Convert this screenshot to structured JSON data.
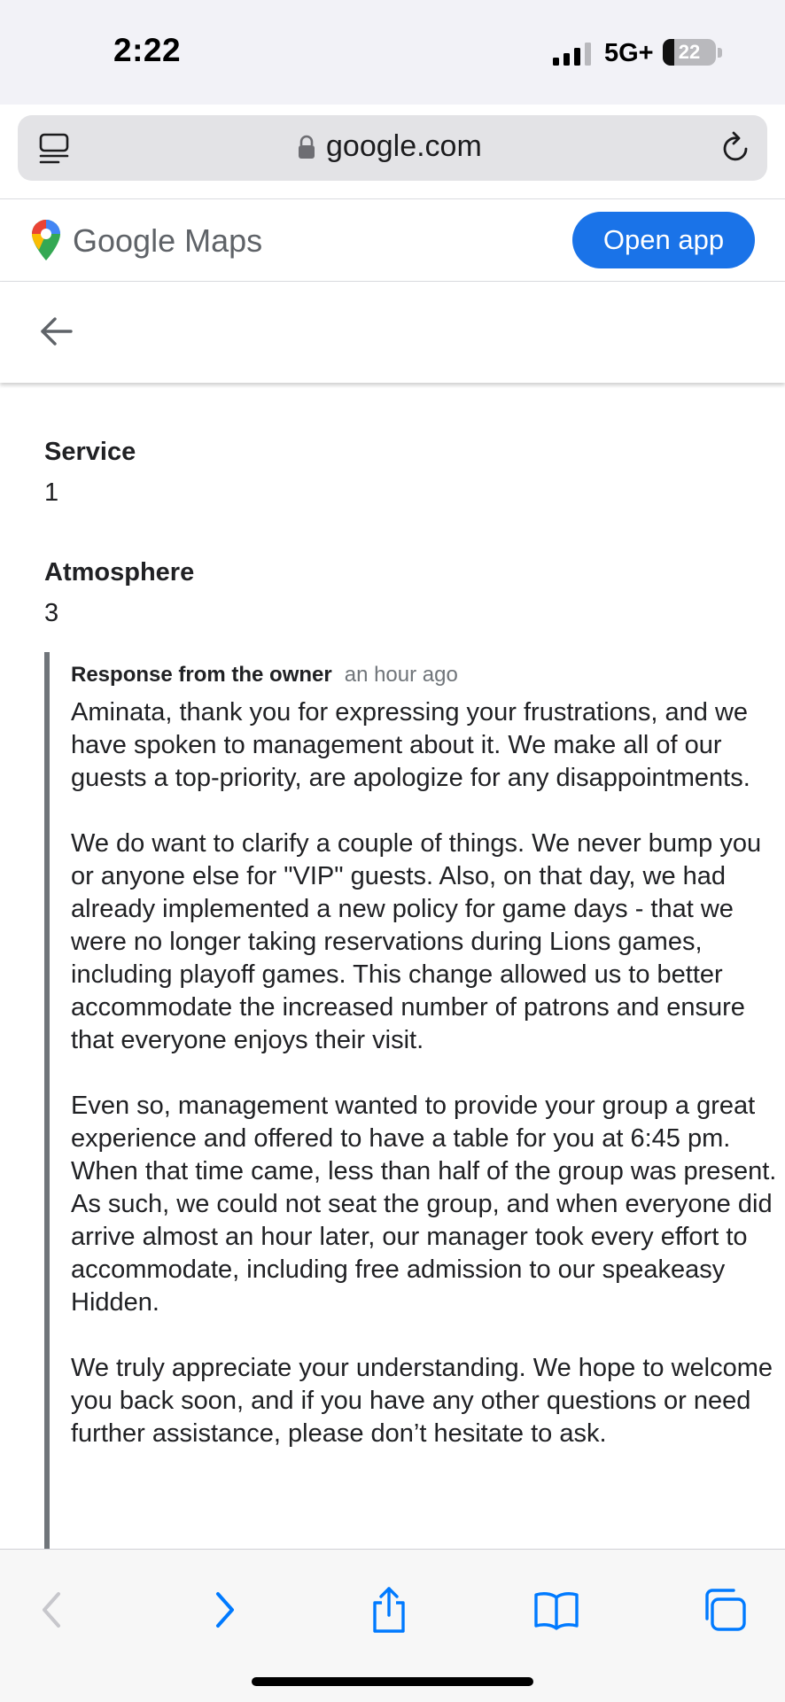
{
  "status_bar": {
    "time": "2:22",
    "network": "5G+",
    "battery_percent": "22",
    "battery_level": 0.22,
    "icons": [
      "cellular-signal-icon",
      "battery-icon"
    ]
  },
  "browser": {
    "url": "google.com",
    "icons": [
      "reader-mode-icon",
      "lock-icon",
      "reload-icon"
    ]
  },
  "maps_header": {
    "brand_google": "Google",
    "brand_maps": "Maps",
    "open_app_label": "Open app",
    "accent_color": "#1a73e8",
    "icons": [
      "google-maps-pin-icon"
    ]
  },
  "nav": {
    "icons": [
      "back-arrow-icon"
    ]
  },
  "ratings": [
    {
      "label": "Service",
      "value": "1"
    },
    {
      "label": "Atmosphere",
      "value": "3"
    }
  ],
  "owner_response": {
    "header": "Response from the owner",
    "time": "an hour ago",
    "paragraphs": [
      "Aminata, thank you for expressing your frustrations, and we have spoken to management about it. We make all of our guests a top-priority, are apologize for any disappointments.",
      "We do want to clarify a couple of things. We never bump you or anyone else for \"VIP\" guests. Also, on that day, we had already implemented a new policy for game days - that we were no longer taking reservations during Lions games, including playoff games. This change allowed us to better accommodate the increased number of patrons and ensure that everyone enjoys their visit.",
      "Even so, management wanted to provide your group a great experience and offered to have a table for you at 6:45 pm. When that time came, less than half of the group was present. As such, we could not seat the group, and when everyone did arrive almost an hour later, our manager took every effort to accommodate, including free admission to our speakeasy Hidden.",
      "We truly appreciate your understanding. We hope to welcome you back soon, and if you have any other questions or need further assistance, please don’t hesitate to ask."
    ]
  },
  "toolbar": {
    "icons": [
      "back-icon",
      "forward-icon",
      "share-icon",
      "bookmarks-icon",
      "tabs-icon"
    ],
    "active_color": "#007aff",
    "disabled_color": "#c7c7cc"
  }
}
